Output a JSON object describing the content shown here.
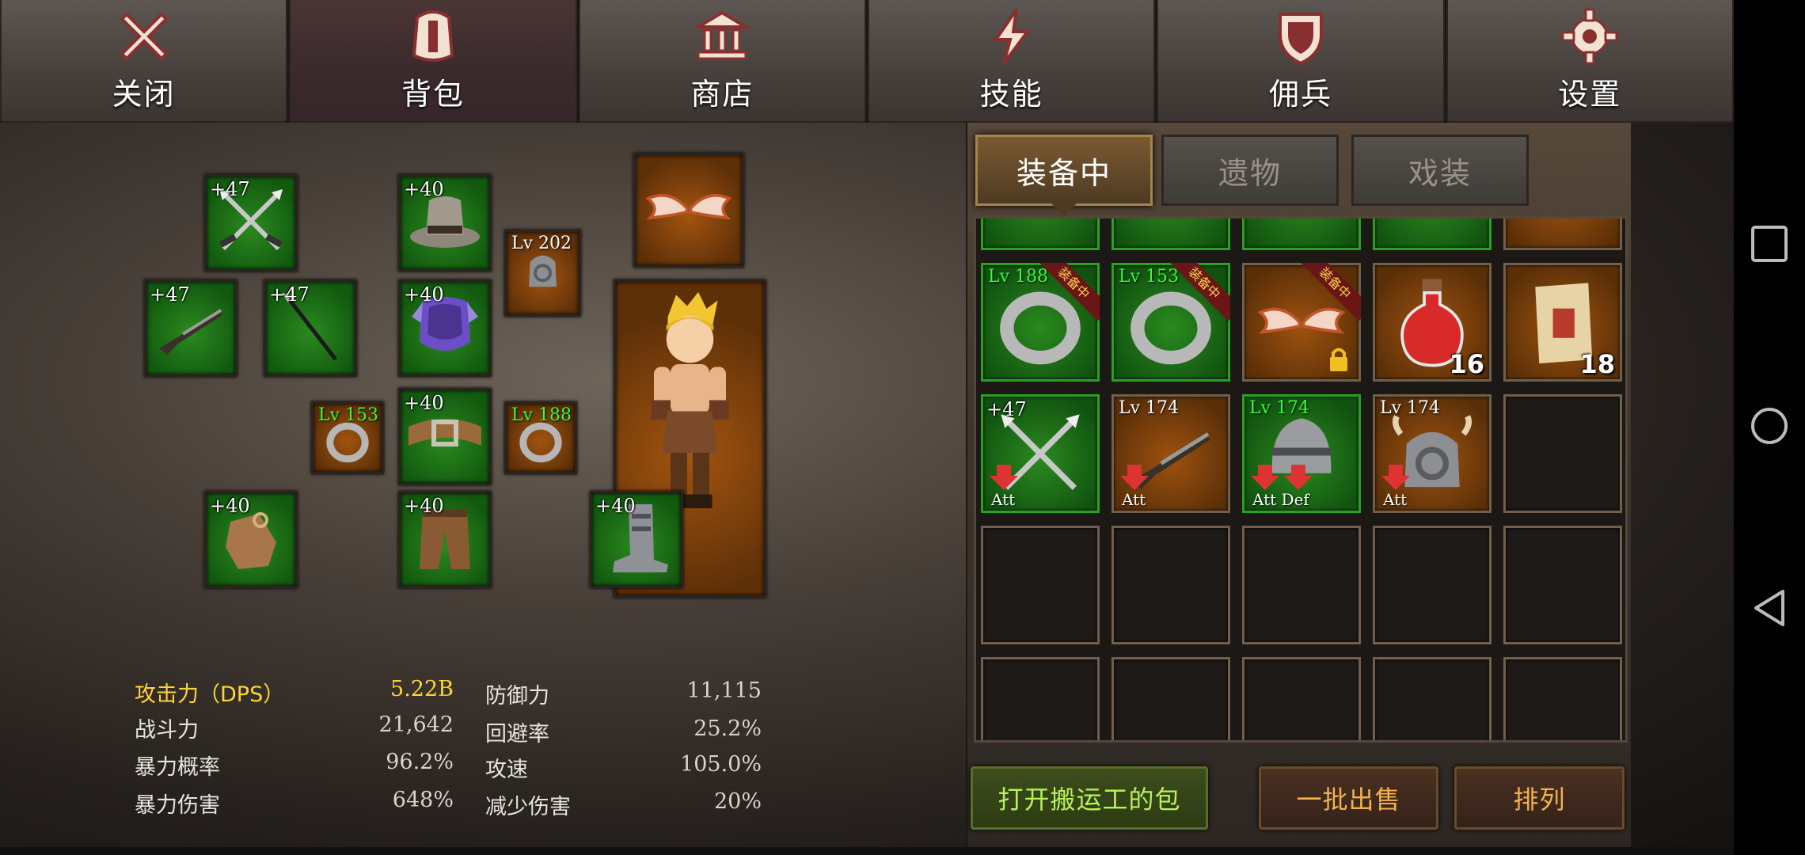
{
  "top_tabs": [
    {
      "label": "关闭",
      "icon": "close-icon"
    },
    {
      "label": "背包",
      "icon": "backpack-icon",
      "active": true
    },
    {
      "label": "商店",
      "icon": "shop-icon"
    },
    {
      "label": "技能",
      "icon": "lightning-icon"
    },
    {
      "label": "佣兵",
      "icon": "shield-icon"
    },
    {
      "label": "设置",
      "icon": "gear-icon"
    }
  ],
  "equipment": {
    "crossed_spears": {
      "tag": "+47"
    },
    "hat": {
      "tag": "+40"
    },
    "pauldron_amulet": {
      "tag": "Lv 202"
    },
    "rifle": {
      "tag": "+47"
    },
    "staff": {
      "tag": "+47"
    },
    "armor": {
      "tag": "+40"
    },
    "ring_left": {
      "tag": "Lv 153"
    },
    "belt": {
      "tag": "+40"
    },
    "ring_right": {
      "tag": "Lv 188"
    },
    "gloves": {
      "tag": "+40"
    },
    "pants": {
      "tag": "+40"
    },
    "boots": {
      "tag": "+40"
    }
  },
  "stats": {
    "atk_label": "攻击力（DPS）",
    "atk_value": "5.22B",
    "power_label": "战斗力",
    "power_value": "21,642",
    "crit_rate_label": "暴力概率",
    "crit_rate_value": "96.2%",
    "crit_dmg_label": "暴力伤害",
    "crit_dmg_value": "648%",
    "def_label": "防御力",
    "def_value": "11,115",
    "evade_label": "回避率",
    "evade_value": "25.2%",
    "aspd_label": "攻速",
    "aspd_value": "105.0%",
    "reduce_label": "减少伤害",
    "reduce_value": "20%"
  },
  "inventory_tabs": [
    {
      "label": "装备中",
      "active": true
    },
    {
      "label": "遗物"
    },
    {
      "label": "戏装"
    }
  ],
  "inventory": {
    "equipped_ribbon": "装备中",
    "row2": [
      {
        "tag": "Lv 188",
        "item": "ring-icon",
        "equipped": true
      },
      {
        "tag": "Lv 153",
        "item": "ring-icon",
        "equipped": true
      },
      {
        "tag": "",
        "item": "wings-icon",
        "equipped": true,
        "locked": true
      },
      {
        "tag": "",
        "item": "potion-icon",
        "count": "16"
      },
      {
        "tag": "",
        "item": "scroll-icon",
        "count": "18"
      }
    ],
    "row3": [
      {
        "tag": "+47",
        "item": "crossed-spears-icon",
        "downgrade": "Att"
      },
      {
        "tag": "Lv 174",
        "item": "rifle-icon",
        "downgrade": "Att"
      },
      {
        "tag": "Lv 174",
        "item": "helmet-icon",
        "downgrade": "Att",
        "downgrade2": "Def"
      },
      {
        "tag": "Lv 174",
        "item": "pauldron-icon",
        "downgrade": "Att"
      }
    ]
  },
  "buttons": {
    "open_porter_bag": "打开搬运工的包",
    "bulk_sell": "一批出售",
    "sort": "排列"
  },
  "colors": {
    "accent_gold": "#ffd43b",
    "rarity_green": "#2a8a1e",
    "rarity_orange": "#9e520f"
  }
}
